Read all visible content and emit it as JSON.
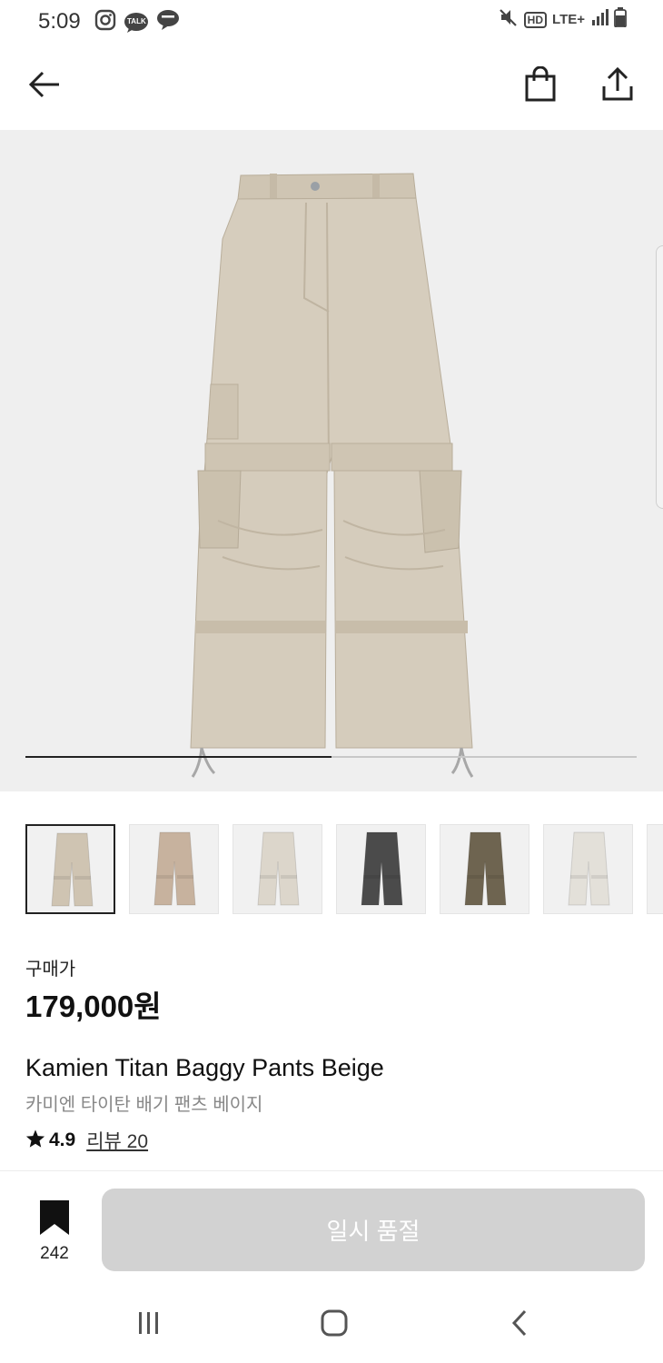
{
  "status_bar": {
    "time": "5:09",
    "left_icons": [
      "instagram-icon",
      "kakaotalk-icon",
      "line-icon"
    ],
    "talk_text": "TALK",
    "hd_text": "HD",
    "network_text": "LTE+",
    "right_icons": [
      "mute-icon",
      "hd-icon",
      "lte-icon",
      "signal-icon",
      "battery-icon"
    ]
  },
  "top_bar": {
    "icons": [
      "back-arrow-icon",
      "shopping-bag-icon",
      "share-icon"
    ]
  },
  "gallery": {
    "progress": 0.5,
    "thumbnails": [
      {
        "color": "#cfc4b2",
        "selected": true
      },
      {
        "color": "#c7b29e",
        "selected": false
      },
      {
        "color": "#dcd6cb",
        "selected": false
      },
      {
        "color": "#4b4b4b",
        "selected": false
      },
      {
        "color": "#6e6450",
        "selected": false
      },
      {
        "color": "#e3e0d9",
        "selected": false
      }
    ]
  },
  "product": {
    "price_label": "구매가",
    "price": "179,000원",
    "name_en": "Kamien Titan Baggy Pants Beige",
    "name_ko": "카미엔 타이탄 배기 팬츠 베이지",
    "rating": "4.9",
    "reviews": "리뷰 20"
  },
  "actions": {
    "bookmark_count": "242",
    "soldout_label": "일시 품절",
    "soldout_color": "#d2d2d2"
  },
  "nav": {
    "icons": [
      "recent-apps-icon",
      "home-icon",
      "back-icon"
    ]
  }
}
